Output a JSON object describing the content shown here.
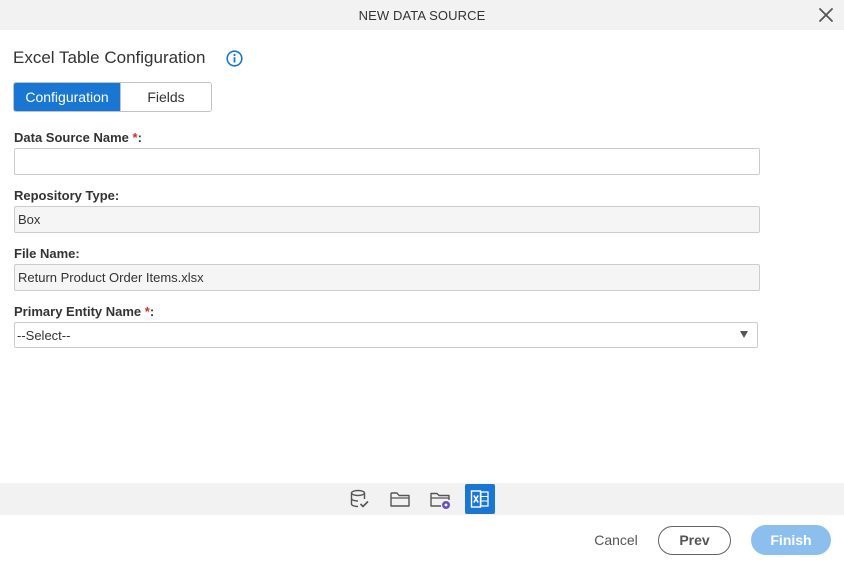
{
  "dialog": {
    "title": "NEW DATA SOURCE"
  },
  "page": {
    "heading": "Excel Table Configuration"
  },
  "tabs": [
    {
      "label": "Configuration",
      "active": true
    },
    {
      "label": "Fields",
      "active": false
    }
  ],
  "form": {
    "data_source_name": {
      "label": "Data Source Name",
      "required_mark": "*",
      "suffix": ":",
      "value": "",
      "placeholder": ""
    },
    "repository_type": {
      "label": "Repository Type:",
      "value": "Box"
    },
    "file_name": {
      "label": "File Name:",
      "value": "Return Product Order Items.xlsx"
    },
    "primary_entity_name": {
      "label": "Primary Entity Name",
      "required_mark": "*",
      "suffix": ":",
      "selected": "--Select--"
    }
  },
  "steps": [
    {
      "icon": "database-check-icon",
      "active": false
    },
    {
      "icon": "folder-icon",
      "active": false
    },
    {
      "icon": "folder-settings-icon",
      "active": false
    },
    {
      "icon": "excel-icon",
      "active": true
    }
  ],
  "footer": {
    "cancel_label": "Cancel",
    "prev_label": "Prev",
    "finish_label": "Finish"
  },
  "colors": {
    "accent": "#1976d2",
    "required": "#d32f2f",
    "finish_disabled": "#8dbfee"
  }
}
